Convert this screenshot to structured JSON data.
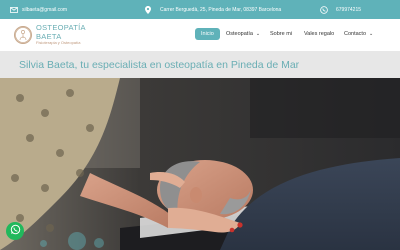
{
  "topbar": {
    "email": "silbaeta@gmail.com",
    "address": "Carrer Berguedà, 25, Pineda de Mar, 08397 Barcelona",
    "phone": "679974215"
  },
  "logo": {
    "line1": "OSTEOPATÍA",
    "line2": "BAETA",
    "tagline": "Fisioterapia y Osteopatía"
  },
  "menu": {
    "items": [
      {
        "label": "Inicio",
        "active": true
      },
      {
        "label": "Osteopatía",
        "dropdown": true
      },
      {
        "label": "Sobre mi"
      },
      {
        "label": "Vales regalo"
      },
      {
        "label": "Contacto",
        "dropdown": true
      }
    ]
  },
  "banner": {
    "title": "Silvia Baeta, tu especialista en osteopatía en Pineda de Mar"
  },
  "colors": {
    "accent": "#5fb2b9",
    "whatsapp": "#21b85c"
  },
  "icons": [
    "mail-icon",
    "location-pin-icon",
    "whatsapp-icon",
    "chevron-down-icon"
  ]
}
